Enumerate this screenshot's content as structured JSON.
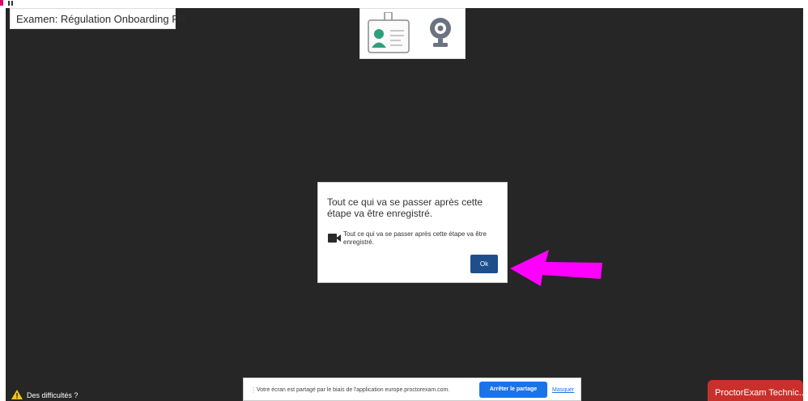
{
  "exam": {
    "title": "Examen: Régulation Onboarding FR"
  },
  "devices": {
    "id_card_icon": "id-card-icon",
    "webcam_icon": "webcam-icon"
  },
  "modal": {
    "title": "Tout ce qui va se passer après cette étape va être enregistré.",
    "message": "Tout ce qui va se passer après cette étape va être enregistré.",
    "ok_label": "Ok"
  },
  "help": {
    "label": "Des difficultés ?"
  },
  "share_bar": {
    "message": "Votre écran est partagé par le biais de l'application europe.proctorexam.com.",
    "stop_label": "Arrêter le partage",
    "hide_label": "Masquer"
  },
  "support": {
    "label": "ProctorExam Technic..."
  },
  "colors": {
    "backdrop": "#262626",
    "ok_button": "#1f4e8c",
    "stop_button": "#1a73e8",
    "support_tab": "#c9302c",
    "annotation_arrow": "#ff00ff"
  }
}
